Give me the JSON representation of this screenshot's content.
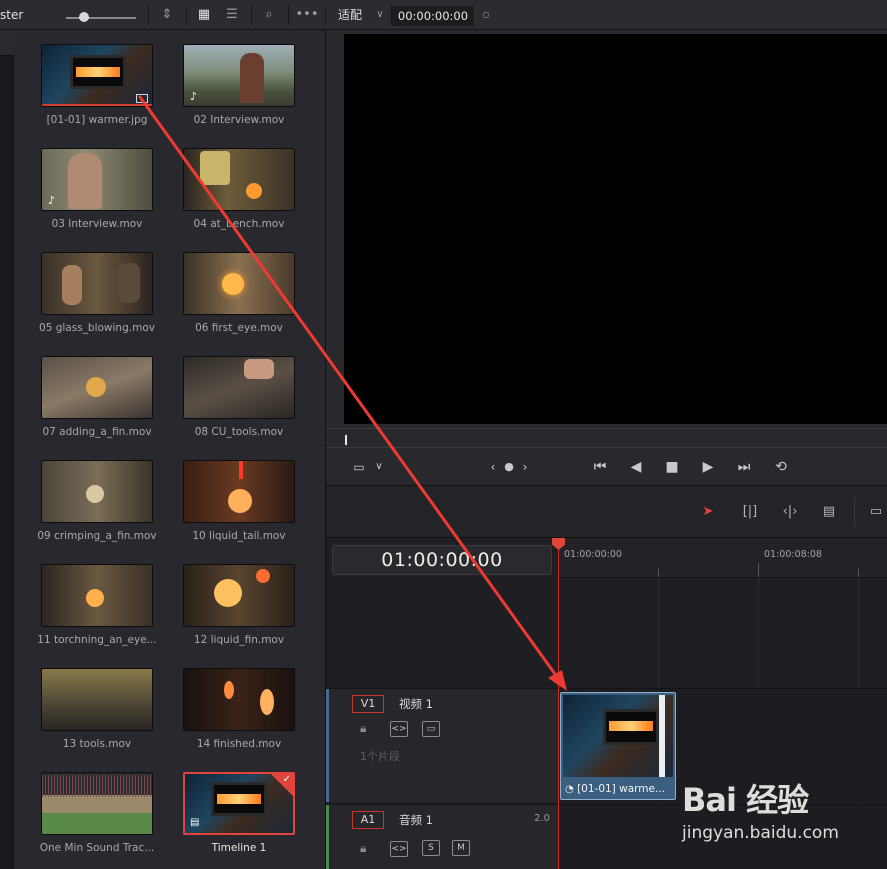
{
  "topbar": {
    "panel_title": "ster",
    "zoom_label": "适配",
    "timecode": "00:00:00:00"
  },
  "media_pool": {
    "clips": [
      {
        "name": "[01-01] warmer.jpg",
        "type": "image",
        "selected": false
      },
      {
        "name": "02 Interview.mov",
        "type": "audio-video"
      },
      {
        "name": "03 Interview.mov",
        "type": "audio-video"
      },
      {
        "name": "04 at_bench.mov",
        "type": "video"
      },
      {
        "name": "05 glass_blowing.mov",
        "type": "video"
      },
      {
        "name": "06 first_eye.mov",
        "type": "video"
      },
      {
        "name": "07 adding_a_fin.mov",
        "type": "video"
      },
      {
        "name": "08 CU_tools.mov",
        "type": "video"
      },
      {
        "name": "09 crimping_a_fin.mov",
        "type": "video"
      },
      {
        "name": "10 liquid_tail.mov",
        "type": "video"
      },
      {
        "name": "11 torchning_an_eye...",
        "type": "video"
      },
      {
        "name": "12 liquid_fin.mov",
        "type": "video"
      },
      {
        "name": "13 tools.mov",
        "type": "video"
      },
      {
        "name": "14 finished.mov",
        "type": "video"
      },
      {
        "name": "One Min Sound Trac...",
        "type": "audio"
      },
      {
        "name": "Timeline 1",
        "type": "timeline",
        "selected": true
      }
    ]
  },
  "timeline": {
    "timecode": "01:00:00:00",
    "ruler": [
      "01:00:00:00",
      "01:00:08:08"
    ],
    "tracks": {
      "v1": {
        "id": "V1",
        "name": "视频 1",
        "clip_count": "1个片段"
      },
      "a1": {
        "id": "A1",
        "name": "音频 1",
        "channels": "2.0",
        "solo": "S",
        "mute": "M"
      }
    },
    "clip": {
      "label": "[01-01] warme..."
    }
  },
  "watermark": {
    "logo": "Bai 经验",
    "url": "jingyan.baidu.com"
  },
  "colors": {
    "accent": "#e0443a",
    "clip_blue": "#3a5f80",
    "panel": "#28282e"
  }
}
